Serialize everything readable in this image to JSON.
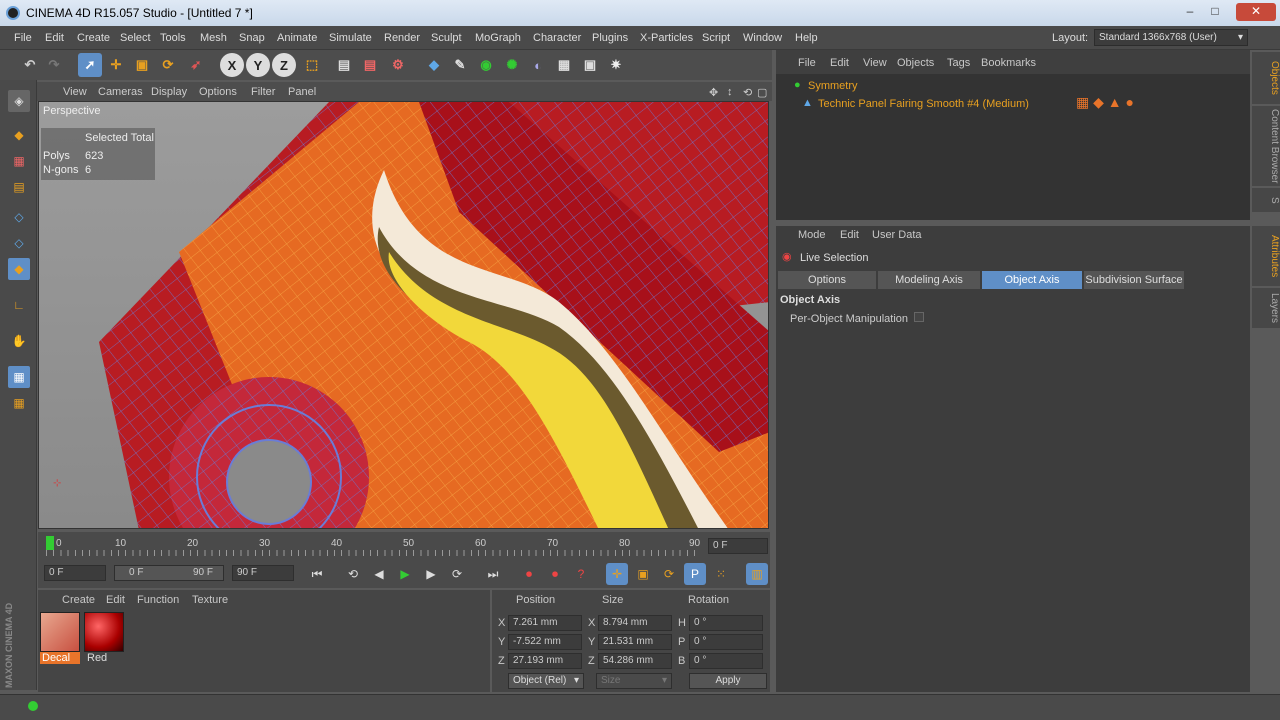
{
  "app": {
    "title": "CINEMA 4D R15.057 Studio - [Untitled 7 *]"
  },
  "window_controls": {
    "minimize": "–",
    "maximize": "□",
    "close": "✕"
  },
  "menubar": {
    "items": [
      "File",
      "Edit",
      "Create",
      "Select",
      "Tools",
      "Mesh",
      "Snap",
      "Animate",
      "Simulate",
      "Render",
      "Sculpt",
      "MoGraph",
      "Character",
      "Plugins",
      "X-Particles",
      "Script",
      "Window",
      "Help"
    ],
    "layout_label": "Layout:",
    "layout_value": "Standard 1366x768 (User)"
  },
  "viewport": {
    "menu": [
      "View",
      "Cameras",
      "Display",
      "Options",
      "Filter",
      "Panel"
    ],
    "label": "Perspective",
    "hud": {
      "header": "Selected Total",
      "polys_label": "Polys",
      "polys_value": "623",
      "ngons_label": "N-gons",
      "ngons_value": "6"
    }
  },
  "timeline": {
    "ticks": [
      "0",
      "10",
      "20",
      "30",
      "40",
      "50",
      "60",
      "70",
      "80",
      "90"
    ],
    "current_frame": "0 F"
  },
  "transport": {
    "start": "0 F",
    "range_start": "0 F",
    "range_end": "90 F",
    "end": "90 F"
  },
  "materials": {
    "menu": [
      "Create",
      "Edit",
      "Function",
      "Texture"
    ],
    "items": [
      {
        "name": "Decal"
      },
      {
        "name": "Red"
      }
    ]
  },
  "coordinates": {
    "headers": [
      "Position",
      "Size",
      "Rotation"
    ],
    "rows": [
      {
        "axis": "X",
        "pos": "7.261 mm",
        "size_axis": "X",
        "size": "8.794 mm",
        "rot_axis": "H",
        "rot": "0 °"
      },
      {
        "axis": "Y",
        "pos": "-7.522 mm",
        "size_axis": "Y",
        "size": "21.531 mm",
        "rot_axis": "P",
        "rot": "0 °"
      },
      {
        "axis": "Z",
        "pos": "27.193 mm",
        "size_axis": "Z",
        "size": "54.286 mm",
        "rot_axis": "B",
        "rot": "0 °"
      }
    ],
    "mode": "Object (Rel)",
    "size_mode": "Size",
    "apply": "Apply"
  },
  "objects": {
    "menu": [
      "File",
      "Edit",
      "View",
      "Objects",
      "Tags",
      "Bookmarks"
    ],
    "items": [
      "Symmetry",
      "Technic Panel Fairing Smooth #4 (Medium)"
    ]
  },
  "attributes": {
    "menu": [
      "Mode",
      "Edit",
      "User Data"
    ],
    "tool": "Live Selection",
    "tabs": [
      "Options",
      "Modeling Axis",
      "Object Axis",
      "Subdivision Surface"
    ],
    "section": "Object Axis",
    "option": "Per-Object Manipulation"
  },
  "sidetabs": [
    "Objects",
    "Content Browser",
    "S",
    "Attributes",
    "Layers"
  ],
  "brand": "MAXON CINEMA 4D",
  "colors": {
    "accent": "#5f8fc7",
    "orange": "#e8742a",
    "yellow": "#f5e050"
  }
}
